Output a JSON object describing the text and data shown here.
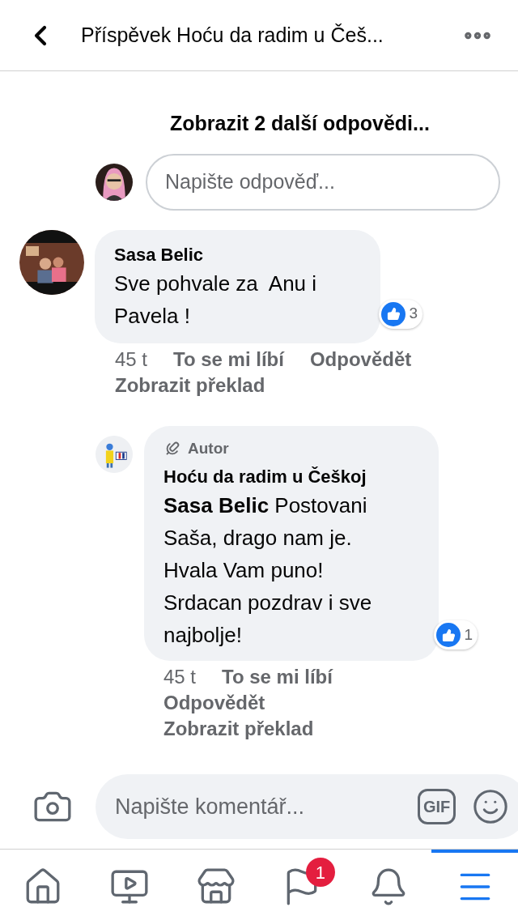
{
  "header": {
    "title": "Příspěvek Hoću da radim u Češ..."
  },
  "more_replies": "Zobrazit 2 další odpovědi...",
  "reply_field": {
    "placeholder": "Napište odpověď..."
  },
  "comments": [
    {
      "kind": "comment",
      "author": "Sasa Belic",
      "text": "Sve pohvale za  Anu i Pavela !",
      "reactions": "3",
      "actions": [
        {
          "kind": "time",
          "label": "45 t"
        },
        {
          "kind": "link",
          "label": "To se mi líbí"
        },
        {
          "kind": "link",
          "label": "Odpovědět"
        },
        {
          "kind": "link",
          "label": "Zobrazit překlad"
        }
      ]
    },
    {
      "kind": "reply",
      "badge": "Autor",
      "author": "Hoću da radim u Češkoj",
      "text": "**Sasa Belic** Postovani Saša, drago nam je. Hvala Vam puno! Srdacan pozdrav i sve najbolje!",
      "reactions": "1",
      "actions": [
        {
          "kind": "time",
          "label": "45 t"
        },
        {
          "kind": "link",
          "label": "To se mi líbí"
        },
        {
          "kind": "link",
          "label": "Odpovědět"
        },
        {
          "kind": "link",
          "label": "Zobrazit překlad"
        }
      ]
    }
  ],
  "composer": {
    "placeholder": "Napište komentář...",
    "gif": "GIF"
  },
  "nav": [
    {
      "kind": "home",
      "selected": false
    },
    {
      "kind": "video",
      "selected": false
    },
    {
      "kind": "marketplace",
      "selected": false
    },
    {
      "kind": "pages",
      "selected": false,
      "badge": "1"
    },
    {
      "kind": "notifications",
      "selected": false
    },
    {
      "kind": "menu",
      "selected": true
    }
  ]
}
